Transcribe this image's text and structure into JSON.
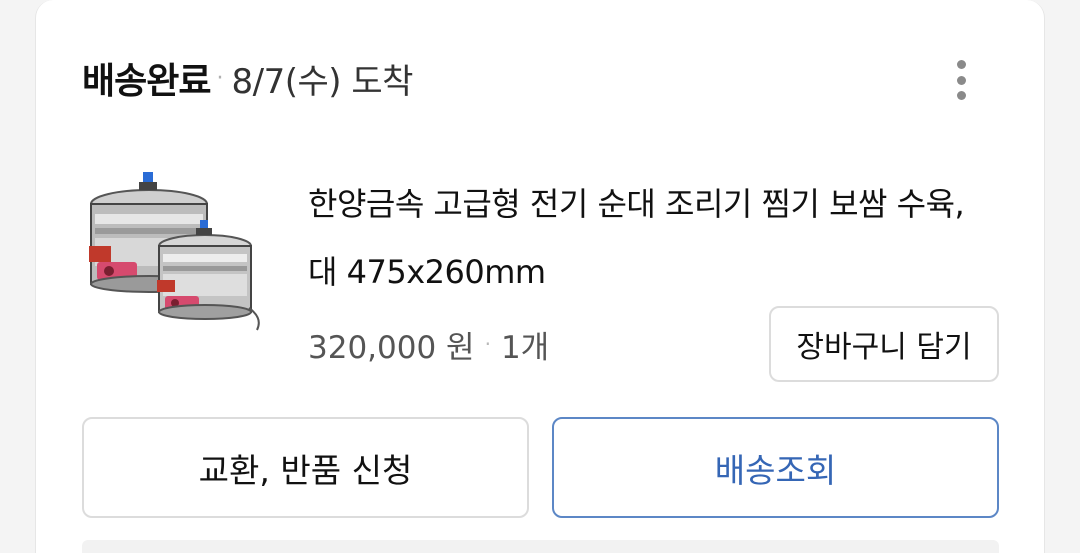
{
  "order": {
    "status": "배송완료",
    "date_text": "8/7(수) 도착",
    "more_icon": "more-vertical-icon"
  },
  "product": {
    "title": "한양금속 고급형 전기 순대 조리기 찜기 보쌈 수육, 대 475x260mm",
    "price": "320,000 원",
    "quantity": "1개",
    "image_icon": "product-thumbnail",
    "cart_button_label": "장바구니 담기"
  },
  "actions": {
    "exchange_return_label": "교환, 반품 신청",
    "track_delivery_label": "배송조회"
  },
  "colors": {
    "accent": "#3566b5",
    "accent_border": "#5c87c6",
    "border": "#dcdcdc",
    "muted_text": "#555555"
  }
}
